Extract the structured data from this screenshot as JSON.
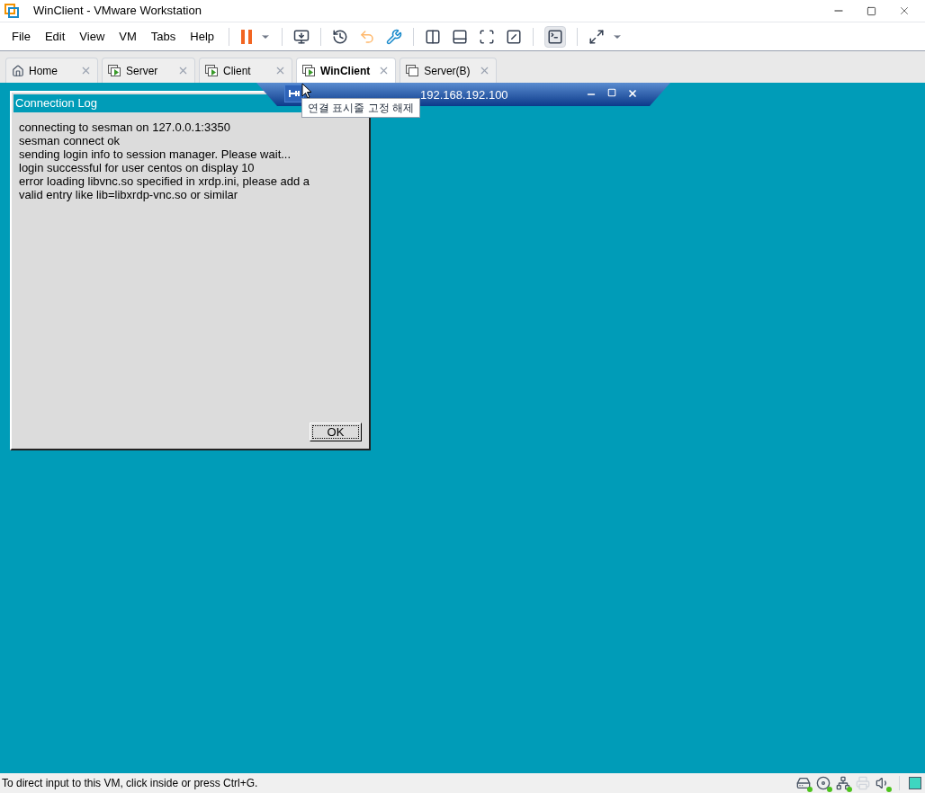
{
  "window": {
    "title": "WinClient - VMware Workstation"
  },
  "menu": [
    "File",
    "Edit",
    "View",
    "VM",
    "Tabs",
    "Help"
  ],
  "tabs": [
    {
      "label": "Home",
      "kind": "home",
      "selected": false
    },
    {
      "label": "Server",
      "kind": "vm",
      "selected": false
    },
    {
      "label": "Client",
      "kind": "vm",
      "selected": false
    },
    {
      "label": "WinClient",
      "kind": "vm",
      "selected": true
    },
    {
      "label": "Server(B)",
      "kind": "vm-off",
      "selected": false
    }
  ],
  "connection_bar": {
    "address": "192.168.192.100",
    "tooltip": "연결 표시줄 고정 해제"
  },
  "dialog": {
    "title": "Connection Log",
    "lines": [
      "connecting to sesman on 127.0.0.1:3350",
      "sesman connect ok",
      "sending login info to session manager. Please wait...",
      "login successful for user centos on display 10",
      "error loading libvnc.so specified in xrdp.ini, please add a",
      "valid entry like lib=libxrdp-vnc.so or similar"
    ],
    "button": "OK"
  },
  "status_bar": {
    "text": "To direct input to this VM, click inside or press Ctrl+G.",
    "devices": [
      {
        "kind": "disk",
        "connected": true
      },
      {
        "kind": "cd",
        "connected": true
      },
      {
        "kind": "network",
        "connected": true
      },
      {
        "kind": "printer",
        "connected": false
      },
      {
        "kind": "sound",
        "connected": true
      }
    ]
  }
}
